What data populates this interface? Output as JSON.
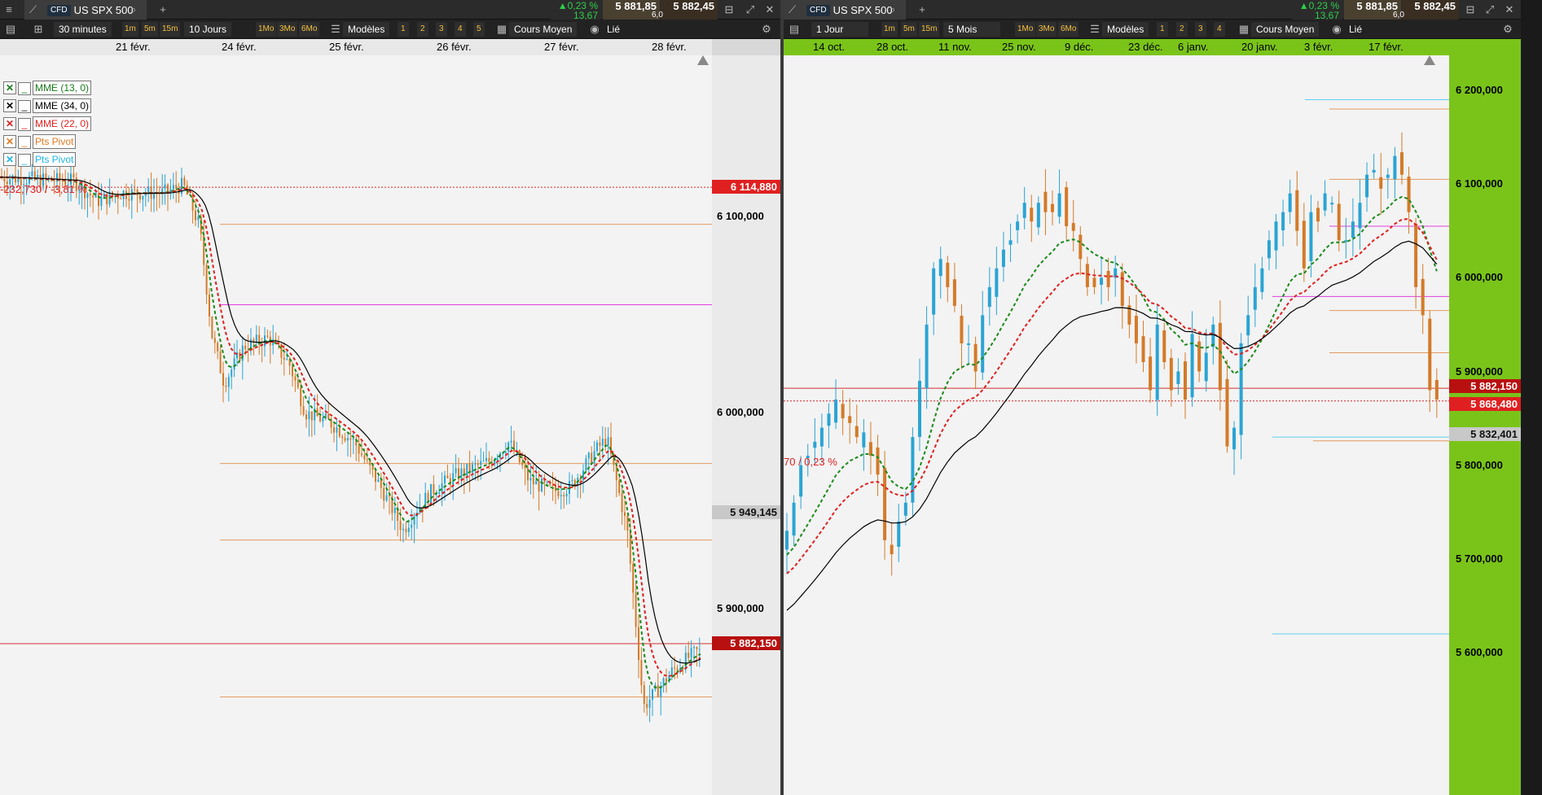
{
  "left": {
    "title": "US SPX 500",
    "cfd": "CFD",
    "change_pct": "▲0,23 %",
    "change_abs": "13,67",
    "bid": "5 881,85",
    "ask": "5 882,45",
    "spread": "6,0",
    "interval": "30 minutes",
    "quick_intervals": [
      "1m",
      "5m",
      "15m"
    ],
    "period": "10 Jours",
    "quick_periods": [
      "1Mo",
      "3Mo",
      "6Mo"
    ],
    "templates": "Modèles",
    "numbers": [
      "1",
      "2",
      "3",
      "4",
      "5"
    ],
    "price_type": "Cours Moyen",
    "link": "Lié",
    "dates": [
      "21 févr.",
      "24 févr.",
      "25 févr.",
      "26 févr.",
      "27 févr.",
      "28 févr."
    ],
    "y_labels": [
      "6 100,000",
      "6 000,000",
      "5 900,000"
    ],
    "price_labels": {
      "pivot_high": "6 114,880",
      "mid": "5 949,145",
      "current": "5 882,150"
    },
    "red_annotation": "-232,730 / -3,81 %",
    "legend": [
      {
        "mark": "✕",
        "label": "MME (13, 0)",
        "color": "#1a7a1a"
      },
      {
        "mark": "✕",
        "label": "MME (34, 0)",
        "color": "#000000"
      },
      {
        "mark": "✕",
        "label": "MME (22, 0)",
        "color": "#e02020"
      },
      {
        "mark": "✕",
        "label": "Pts Pivot",
        "color": "#e07a20"
      },
      {
        "mark": "✕",
        "label": "Pts Pivot",
        "color": "#1eb4e6"
      }
    ]
  },
  "right": {
    "title": "US SPX 500",
    "cfd": "CFD",
    "change_pct": "▲0,23 %",
    "change_abs": "13,67",
    "bid": "5 881,85",
    "ask": "5 882,45",
    "spread": "6,0",
    "interval": "1 Jour",
    "quick_intervals": [
      "1m",
      "5m",
      "15m"
    ],
    "period": "5 Mois",
    "quick_periods": [
      "1Mo",
      "3Mo",
      "6Mo"
    ],
    "templates": "Modèles",
    "numbers": [
      "1",
      "2",
      "3",
      "4"
    ],
    "price_type": "Cours Moyen",
    "link": "Lié",
    "dates": [
      "14 oct.",
      "28 oct.",
      "11 nov.",
      "25 nov.",
      "9 déc.",
      "23 déc.",
      "6 janv.",
      "20 janv.",
      "3 févr.",
      "17 févr."
    ],
    "y_labels": [
      "6 200,000",
      "6 100,000",
      "6 000,000",
      "5 900,000",
      "5 800,000",
      "5 700,000",
      "5 600,000"
    ],
    "price_labels": {
      "current": "5 882,150",
      "low": "5 868,480",
      "pivot": "5 832,401"
    },
    "red_annotation": "70 / 0,23 %"
  },
  "colors": {
    "bull": "#2aa4d4",
    "bear": "#d47a28",
    "ema13": "#1a8a1a",
    "ema22": "#e02020",
    "ema34": "#000000",
    "pivot_orange": "#e49a60",
    "pivot_magenta": "#e040e0",
    "pivot_cyan": "#5ad0f0",
    "axis_green": "#7ac41a"
  }
}
